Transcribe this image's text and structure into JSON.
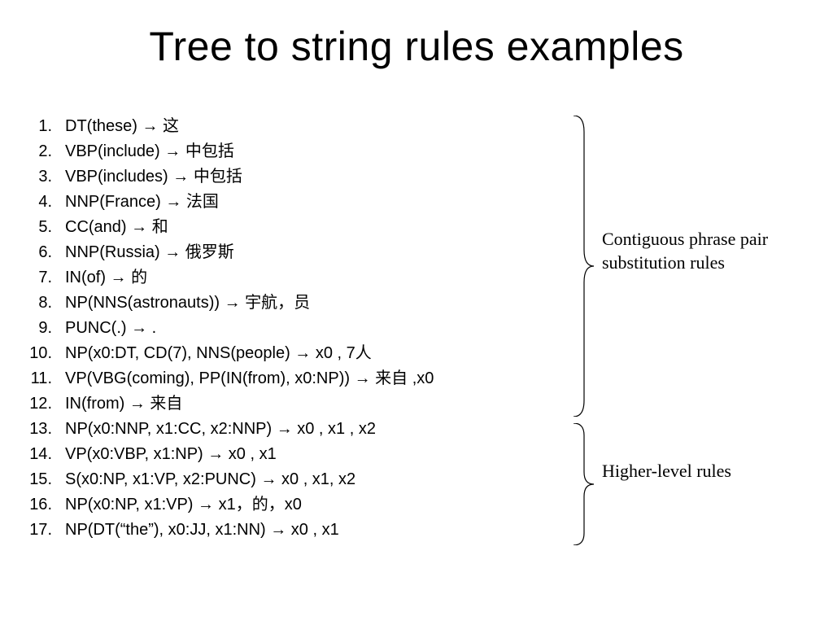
{
  "title": "Tree to string rules examples",
  "rules": [
    "DT(these) → 这",
    "VBP(include) → 中包括",
    "VBP(includes) → 中包括",
    "NNP(France) → 法国",
    "CC(and) → 和",
    "NNP(Russia) → 俄罗斯",
    "IN(of) → 的",
    "NP(NNS(astronauts)) → 宇航，员",
    "PUNC(.) → .",
    "NP(x0:DT, CD(7), NNS(people) →  x0 , 7人",
    "VP(VBG(coming), PP(IN(from), x0:NP)) → 来自 ,x0",
    "IN(from) → 来自",
    "NP(x0:NNP, x1:CC, x2:NNP) → x0 , x1 , x2",
    "VP(x0:VBP, x1:NP) → x0 , x1",
    "S(x0:NP, x1:VP, x2:PUNC) → x0 , x1, x2",
    "NP(x0:NP, x1:VP) → x1，的，x0",
    "NP(DT(“the”), x0:JJ, x1:NN) → x0 , x1"
  ],
  "annotations": {
    "upper": "Contiguous phrase pair substitution rules",
    "lower": "Higher-level rules"
  }
}
